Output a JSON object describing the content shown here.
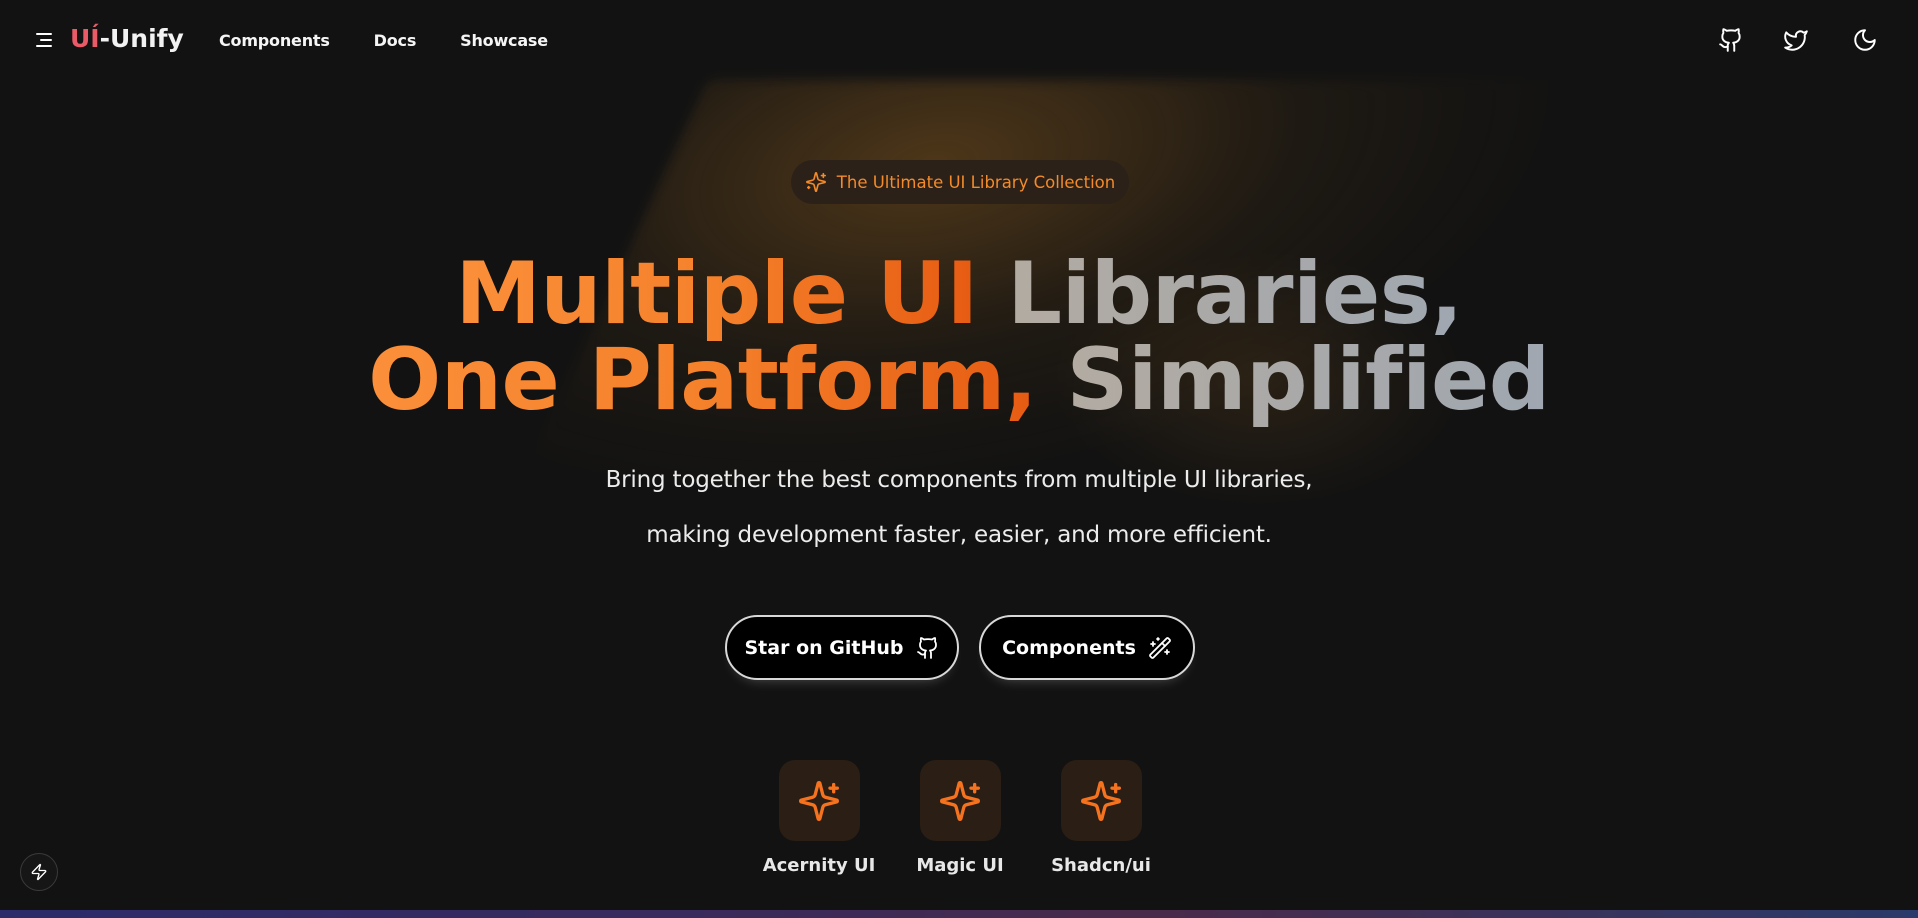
{
  "header": {
    "logo_accent": "UÍ",
    "logo_rest": "-Unify",
    "nav": [
      "Components",
      "Docs",
      "Showcase"
    ],
    "icons": [
      "github-icon",
      "twitter-icon",
      "moon-icon"
    ]
  },
  "hero": {
    "badge": "The Ultimate UI Library Collection",
    "headline": {
      "line1_orange": "Multiple UI",
      "line1_gray": "Libraries,",
      "line2_orange": "One Platform,",
      "line2_gray": "Simplified"
    },
    "subtitle_line1": "Bring together the best components from multiple UI libraries,",
    "subtitle_line2": "making development faster, easier, and more efficient.",
    "buttons": {
      "github": "Star on GitHub",
      "components": "Components"
    }
  },
  "libraries": [
    "Acernity UI",
    "Magic UI",
    "Shadcn/ui"
  ],
  "colors": {
    "background": "#121212",
    "accent_orange": "#f5812b",
    "logo_accent": "#ea5a67",
    "tile_bg": "#2a1e15"
  }
}
